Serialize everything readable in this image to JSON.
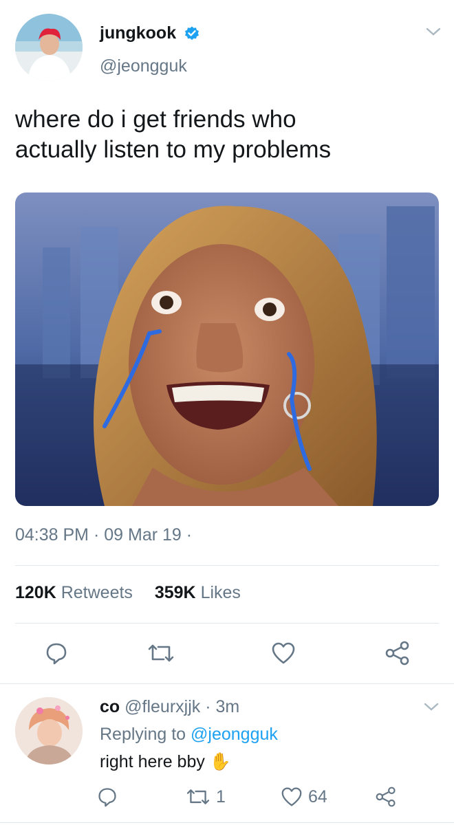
{
  "tweet": {
    "author_name": "jungkook",
    "author_handle": "@jeongguk",
    "text_line1": "where do i get friends who",
    "text_line2": "actually listen to my problems",
    "time": "04:38 PM",
    "date": "09 Mar 19",
    "sep1": "·",
    "sep2": "·",
    "retweets_count": "120K",
    "retweets_label": "Retweets",
    "likes_count": "359K",
    "likes_label": "Likes"
  },
  "reply": {
    "author_name": "co",
    "author_handle": "@fleurxjjk",
    "sep": "·",
    "age": "3m",
    "replying_prefix": "Replying to",
    "replying_handle": "@jeongguk",
    "text": "right here bby",
    "emoji": "✋",
    "retweets": "1",
    "likes": "64"
  },
  "icons": {
    "verified": "verified-badge-icon",
    "chevron": "chevron-down-icon",
    "reply": "reply-icon",
    "retweet": "retweet-icon",
    "like": "heart-icon",
    "share": "share-icon"
  },
  "colors": {
    "accent": "#1da1f2",
    "text": "#14171a",
    "secondary": "#657786",
    "divider": "#e1e8ed"
  }
}
